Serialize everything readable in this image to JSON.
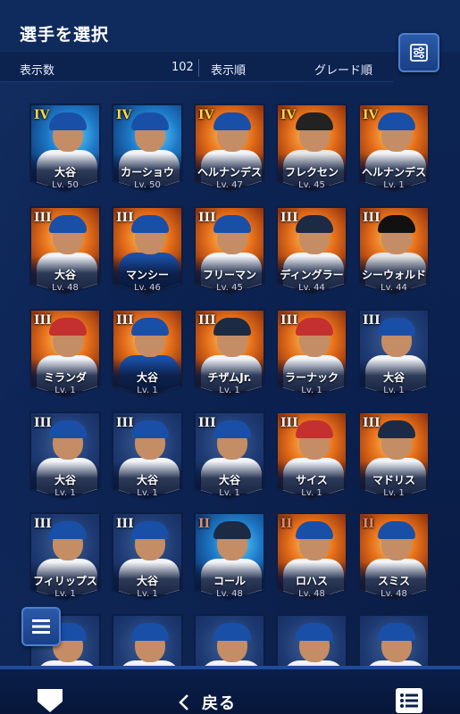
{
  "header": {
    "title": "選手を選択"
  },
  "info": {
    "count_label": "表示数",
    "count_value": "102",
    "order_label": "表示順",
    "order_value": "グレード順"
  },
  "cards": [
    {
      "grade": "IV",
      "name": "大谷",
      "level": "Lv. 50",
      "bg": "blue",
      "tier": "gold",
      "cap": "#1a4fa8",
      "shirt": "#f2f4f8"
    },
    {
      "grade": "IV",
      "name": "カーショウ",
      "level": "Lv. 50",
      "bg": "blue",
      "tier": "gold",
      "cap": "#1a4fa8",
      "shirt": "#f2f4f8"
    },
    {
      "grade": "IV",
      "name": "ヘルナンデス",
      "level": "Lv. 47",
      "bg": "orange",
      "tier": "gold",
      "cap": "#1a4fa8",
      "shirt": "#f2f4f8"
    },
    {
      "grade": "IV",
      "name": "フレクセン",
      "level": "Lv. 45",
      "bg": "orange",
      "tier": "gold",
      "cap": "#222222",
      "shirt": "#e8e8e8"
    },
    {
      "grade": "IV",
      "name": "ヘルナンデス",
      "level": "Lv. 1",
      "bg": "orange",
      "tier": "gold",
      "cap": "#1a4fa8",
      "shirt": "#f2f4f8"
    },
    {
      "grade": "III",
      "name": "大谷",
      "level": "Lv. 48",
      "bg": "orange",
      "tier": "silver",
      "cap": "#1a4fa8",
      "shirt": "#f2f4f8"
    },
    {
      "grade": "III",
      "name": "マンシー",
      "level": "Lv. 46",
      "bg": "orange",
      "tier": "silver",
      "cap": "#1a4fa8",
      "shirt": "#1a4fa8"
    },
    {
      "grade": "III",
      "name": "フリーマン",
      "level": "Lv. 45",
      "bg": "orange",
      "tier": "silver",
      "cap": "#1a4fa8",
      "shirt": "#f2f4f8"
    },
    {
      "grade": "III",
      "name": "ディングラー",
      "level": "Lv. 44",
      "bg": "orange",
      "tier": "silver",
      "cap": "#1d2a44",
      "shirt": "#f2f4f8"
    },
    {
      "grade": "III",
      "name": "シーウォルド",
      "level": "Lv. 44",
      "bg": "orange",
      "tier": "silver",
      "cap": "#111111",
      "shirt": "#e4e4e4"
    },
    {
      "grade": "III",
      "name": "ミランダ",
      "level": "Lv. 1",
      "bg": "orange",
      "tier": "silver",
      "cap": "#c43030",
      "shirt": "#f2f4f8"
    },
    {
      "grade": "III",
      "name": "大谷",
      "level": "Lv. 1",
      "bg": "orange",
      "tier": "silver",
      "cap": "#1a4fa8",
      "shirt": "#1a4fa8"
    },
    {
      "grade": "III",
      "name": "チザムJr.",
      "level": "Lv. 1",
      "bg": "orange",
      "tier": "silver",
      "cap": "#1d2a44",
      "shirt": "#f2f4f8"
    },
    {
      "grade": "III",
      "name": "ラーナック",
      "level": "Lv. 1",
      "bg": "orange",
      "tier": "silver",
      "cap": "#c43030",
      "shirt": "#f2f4f8"
    },
    {
      "grade": "III",
      "name": "大谷",
      "level": "Lv. 1",
      "bg": "dark",
      "tier": "silver",
      "cap": "#1a4fa8",
      "shirt": "#f2f4f8"
    },
    {
      "grade": "III",
      "name": "大谷",
      "level": "Lv. 1",
      "bg": "dark",
      "tier": "silver",
      "cap": "#1a4fa8",
      "shirt": "#f2f4f8"
    },
    {
      "grade": "III",
      "name": "大谷",
      "level": "Lv. 1",
      "bg": "dark",
      "tier": "silver",
      "cap": "#1a4fa8",
      "shirt": "#f2f4f8"
    },
    {
      "grade": "III",
      "name": "大谷",
      "level": "Lv. 1",
      "bg": "dark",
      "tier": "silver",
      "cap": "#1a4fa8",
      "shirt": "#f2f4f8"
    },
    {
      "grade": "III",
      "name": "サイス",
      "level": "Lv. 1",
      "bg": "orange",
      "tier": "silver",
      "cap": "#c43030",
      "shirt": "#f2f4f8"
    },
    {
      "grade": "III",
      "name": "マドリス",
      "level": "Lv. 1",
      "bg": "orange",
      "tier": "silver",
      "cap": "#1d2a44",
      "shirt": "#f2f4f8"
    },
    {
      "grade": "III",
      "name": "フィリップス",
      "level": "Lv. 1",
      "bg": "dark",
      "tier": "silver",
      "cap": "#1a4fa8",
      "shirt": "#f2f4f8"
    },
    {
      "grade": "III",
      "name": "大谷",
      "level": "Lv. 1",
      "bg": "dark",
      "tier": "silver",
      "cap": "#1a4fa8",
      "shirt": "#f2f4f8"
    },
    {
      "grade": "II",
      "name": "コール",
      "level": "Lv. 48",
      "bg": "blue",
      "tier": "bronze",
      "cap": "#1d2a44",
      "shirt": "#f2f4f8"
    },
    {
      "grade": "II",
      "name": "ロハス",
      "level": "Lv. 48",
      "bg": "orange",
      "tier": "bronze",
      "cap": "#1a4fa8",
      "shirt": "#f2f4f8"
    },
    {
      "grade": "II",
      "name": "スミス",
      "level": "Lv. 48",
      "bg": "orange",
      "tier": "bronze",
      "cap": "#1a4fa8",
      "shirt": "#f2f4f8"
    },
    {
      "grade": "",
      "name": "",
      "level": "",
      "bg": "dark",
      "tier": "silver",
      "cap": "#1a4fa8",
      "shirt": "#f2f4f8"
    },
    {
      "grade": "",
      "name": "",
      "level": "",
      "bg": "dark",
      "tier": "silver",
      "cap": "#1a4fa8",
      "shirt": "#f2f4f8"
    },
    {
      "grade": "",
      "name": "",
      "level": "",
      "bg": "dark",
      "tier": "bronze",
      "cap": "#1a4fa8",
      "shirt": "#f2f4f8"
    },
    {
      "grade": "",
      "name": "",
      "level": "",
      "bg": "dark",
      "tier": "bronze",
      "cap": "#1a4fa8",
      "shirt": "#f2f4f8"
    },
    {
      "grade": "",
      "name": "",
      "level": "",
      "bg": "dark",
      "tier": "bronze",
      "cap": "#1a4fa8",
      "shirt": "#f2f4f8"
    }
  ],
  "footer": {
    "back_label": "戻る",
    "home_icon": "home-plate-icon",
    "list_icon": "list-icon"
  },
  "colors": {
    "background": "#0b2150",
    "accent": "#2b5aa8",
    "grade_gold": "#ffd34a",
    "grade_silver": "#f2f2f2",
    "grade_bronze": "#e08a6a"
  }
}
